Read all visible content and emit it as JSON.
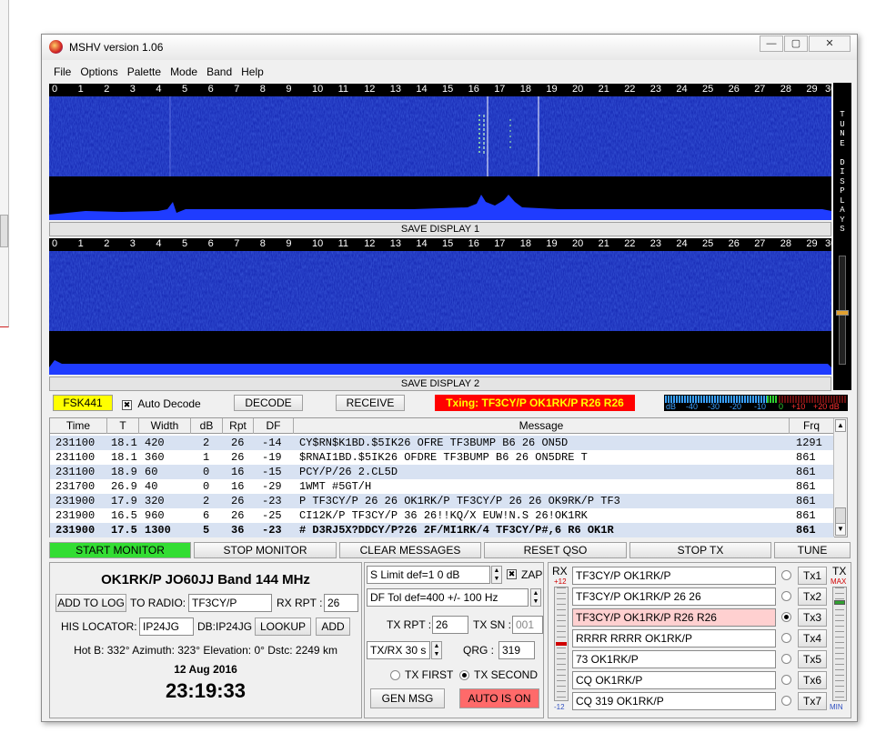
{
  "window": {
    "title": "MSHV version 1.06",
    "min": "—",
    "max": "▢",
    "close": "✕"
  },
  "menu": [
    "File",
    "Options",
    "Palette",
    "Mode",
    "Band",
    "Help"
  ],
  "scale_ticks": [
    "0",
    "1",
    "2",
    "3",
    "4",
    "5",
    "6",
    "7",
    "8",
    "9",
    "10",
    "11",
    "12",
    "13",
    "14",
    "15",
    "16",
    "17",
    "18",
    "19",
    "20",
    "21",
    "22",
    "23",
    "24",
    "25",
    "26",
    "27",
    "28",
    "29",
    "30"
  ],
  "display1": {
    "save_label": "SAVE DISPLAY 1"
  },
  "display2": {
    "save_label": "SAVE DISPLAY 2"
  },
  "tune_display_label": "TUNE DISPLAYS",
  "modebar": {
    "mode": "FSK441",
    "auto_decode_label": "Auto Decode",
    "auto_decode_checked": true,
    "decode_label": "DECODE",
    "receive_label": "RECEIVE",
    "txing": "Txing: TF3CY/P OK1RK/P R26 R26",
    "meter_scale": [
      "dB",
      "-40",
      "-30",
      "-20",
      "-10",
      "0",
      "+10",
      "+20 dB"
    ]
  },
  "table": {
    "headers": [
      "Time",
      "T",
      "Width",
      "dB",
      "Rpt",
      "DF",
      "Message",
      "Frq"
    ],
    "rows": [
      {
        "time": "231100",
        "t": "18.1",
        "width": "420",
        "db": "2",
        "rpt": "26",
        "df": "-14",
        "msg": "CY$RN$K1BD.$5IK26 OFRE TF3BUMP B6 26 ON5D",
        "frq": "1291"
      },
      {
        "time": "231100",
        "t": "18.1",
        "width": "360",
        "db": "1",
        "rpt": "26",
        "df": "-19",
        "msg": "$RNAI1BD.$5IK26 OFDRE TF3BUMP B6 26 ON5DRE T",
        "frq": "861"
      },
      {
        "time": "231100",
        "t": "18.9",
        "width": "60",
        "db": "0",
        "rpt": "16",
        "df": "-15",
        "msg": "PCY/P/26 2.CL5D",
        "frq": "861"
      },
      {
        "time": "231700",
        "t": "26.9",
        "width": "40",
        "db": "0",
        "rpt": "16",
        "df": "-29",
        "msg": "1WMT #5GT/H",
        "frq": "861"
      },
      {
        "time": "231900",
        "t": "17.9",
        "width": "320",
        "db": "2",
        "rpt": "26",
        "df": "-23",
        "msg": "P TF3CY/P 26 26 OK1RK/P TF3CY/P 26 26 OK9RK/P TF3",
        "frq": "861"
      },
      {
        "time": "231900",
        "t": "16.5",
        "width": "960",
        "db": "6",
        "rpt": "26",
        "df": "-25",
        "msg": "CI12K/P TF3CY/P 36 26!!KQ/X EUW!N.S 26!OK1RK",
        "frq": "861"
      },
      {
        "time": "231900",
        "t": "17.5",
        "width": "1300",
        "db": "5",
        "rpt": "36",
        "df": "-23",
        "msg": "# D3RJ5X?DDCY/P?26 2F/MI1RK/4 TF3CY/P#,6 R6 OK1R",
        "frq": "861"
      }
    ]
  },
  "controls": {
    "start_monitor": "START MONITOR",
    "stop_monitor": "STOP MONITOR",
    "clear_messages": "CLEAR MESSAGES",
    "reset_qso": "RESET QSO",
    "stop_tx": "STOP TX",
    "tune": "TUNE"
  },
  "station": {
    "callsign_line": "OK1RK/P JO60JJ   Band 144 MHz",
    "add_to_log": "ADD TO LOG",
    "to_radio_label": "TO RADIO:",
    "to_radio_value": "TF3CY/P",
    "rx_rpt_label": "RX RPT :",
    "rx_rpt_value": "26",
    "his_locator_label": "HIS LOCATOR:",
    "his_locator_value": "IP24JG",
    "db_label": "DB:IP24JG",
    "lookup": "LOOKUP",
    "add": "ADD",
    "info_line": "Hot B: 332°   Azimuth: 323°   Elevation: 0°   Dstc: 2249 km",
    "date": "12 Aug 2016",
    "time": "23:19:33"
  },
  "settings": {
    "s_limit": "S Limit def=1  0  dB",
    "zap_label": "ZAP",
    "zap_checked": true,
    "df_tol": "DF Tol def=400 +/-  100  Hz",
    "tx_rpt_label": "TX RPT :",
    "tx_rpt_value": "26",
    "tx_sn_label": "TX SN :",
    "tx_sn_value": "001",
    "txrx_period": "TX/RX 30 s",
    "qrg_label": "QRG :",
    "qrg_value": "319",
    "tx_first": "TX FIRST",
    "tx_second": "TX SECOND",
    "gen_msg": "GEN MSG",
    "auto_is_on": "AUTO IS ON"
  },
  "tx_messages": {
    "rx_label": "RX",
    "rx_top": "+12",
    "rx_bottom": "-12",
    "tx_label": "TX",
    "tx_top": "MAX",
    "tx_bottom": "MIN",
    "items": [
      {
        "text": "TF3CY/P OK1RK/P",
        "btn": "Tx1",
        "selected": false
      },
      {
        "text": "TF3CY/P OK1RK/P 26 26",
        "btn": "Tx2",
        "selected": false
      },
      {
        "text": "TF3CY/P OK1RK/P R26 R26",
        "btn": "Tx3",
        "selected": true
      },
      {
        "text": "RRRR RRRR OK1RK/P",
        "btn": "Tx4",
        "selected": false
      },
      {
        "text": "73 OK1RK/P",
        "btn": "Tx5",
        "selected": false
      },
      {
        "text": "CQ OK1RK/P",
        "btn": "Tx6",
        "selected": false
      },
      {
        "text": "CQ 319 OK1RK/P",
        "btn": "Tx7",
        "selected": false
      }
    ]
  },
  "colors": {
    "waterfall_bg": "#1a2eb8",
    "mode_yellow": "#ffff00",
    "txing_red": "#ff0000",
    "start_green": "#33dd33",
    "auto_on_red": "#ff6a6a",
    "selected_tx_pink": "#ffd0d0"
  }
}
